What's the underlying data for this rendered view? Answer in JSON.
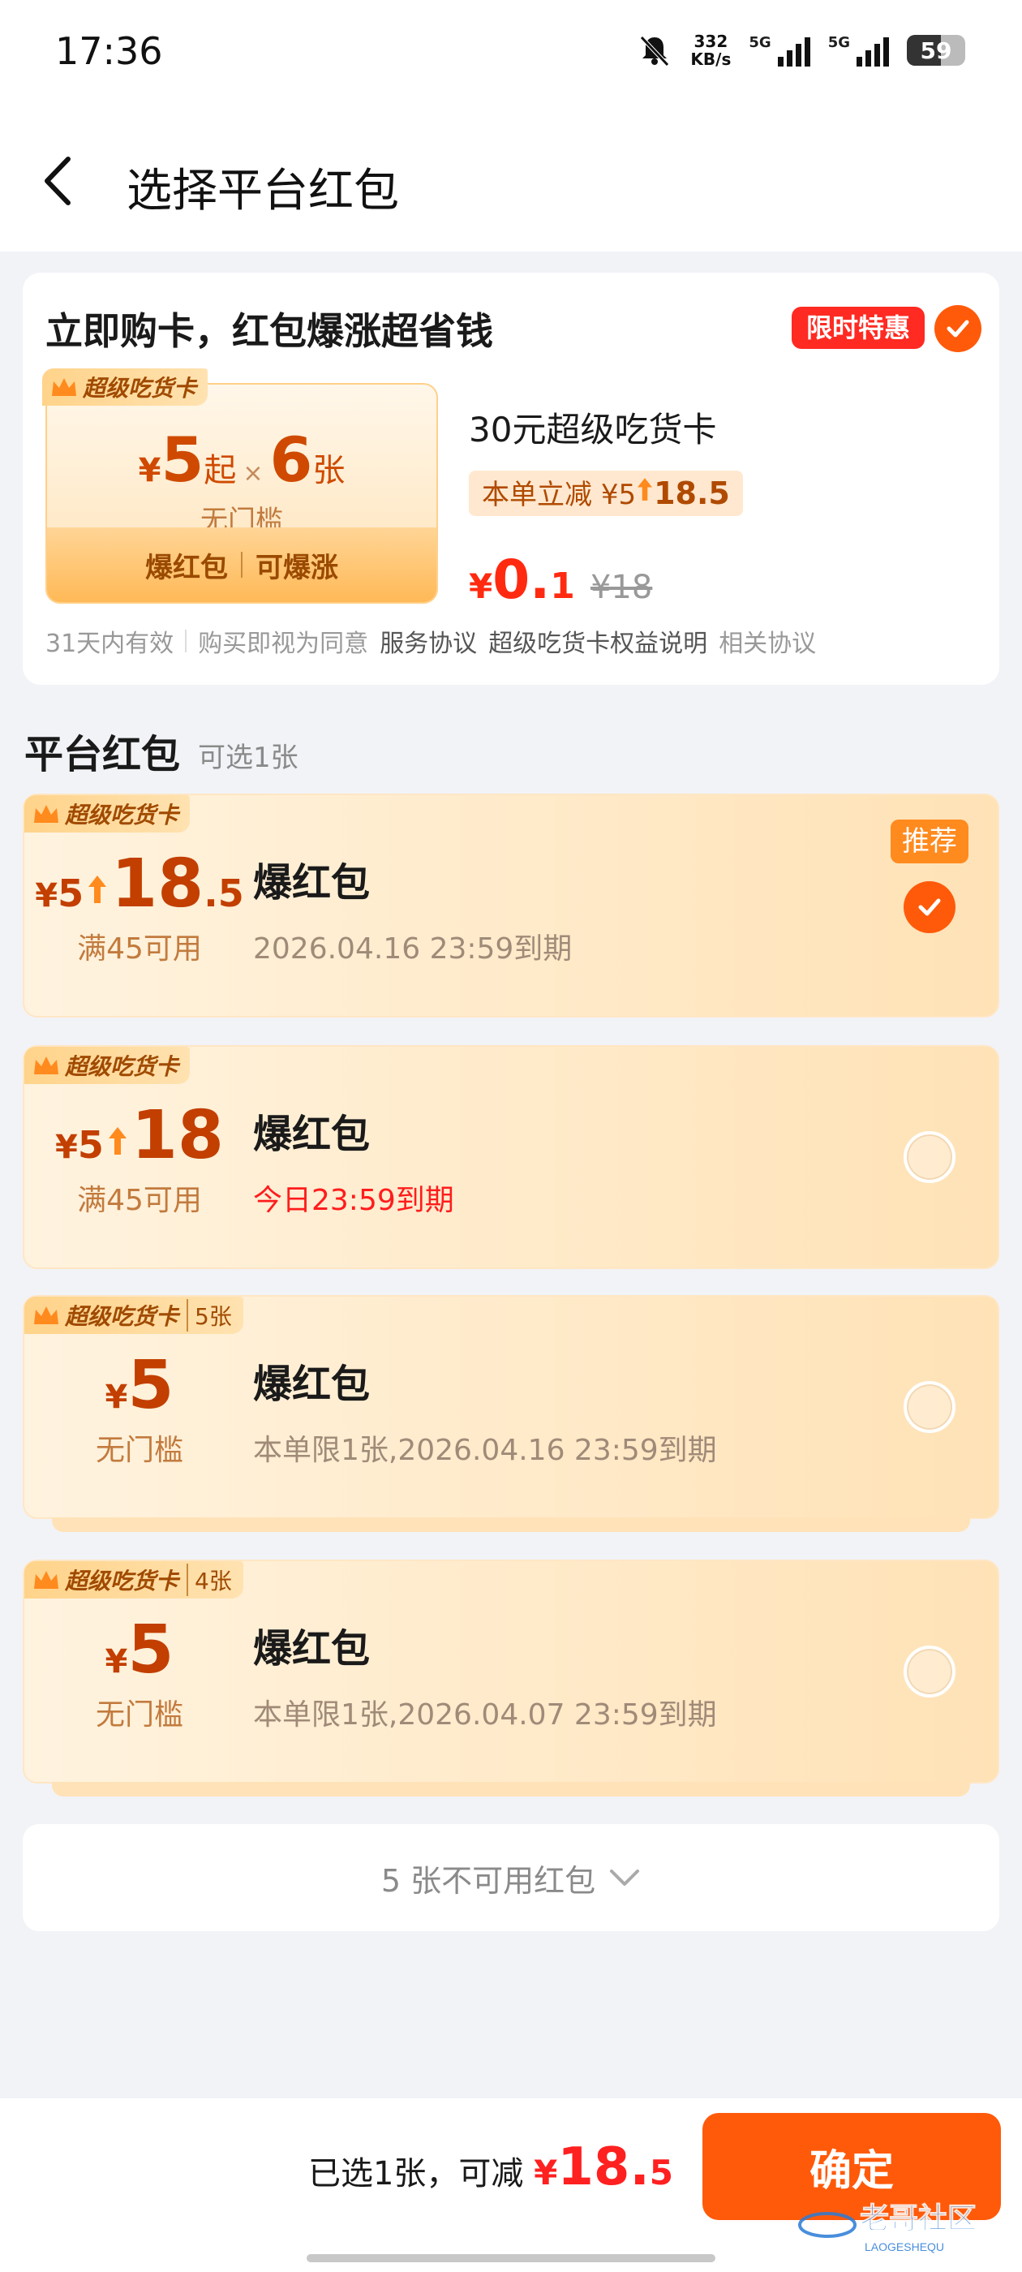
{
  "status_bar": {
    "time": "17:36",
    "net_speed_value": "332",
    "net_speed_unit": "KB/s",
    "sig1": "5G",
    "sig2": "5G",
    "battery": "59"
  },
  "nav": {
    "title": "选择平台红包"
  },
  "promo": {
    "headline": "立即购卡，红包爆涨超省钱",
    "badge": "限时特惠",
    "tag": "超级吃货卡",
    "yen": "¥",
    "amount_from": "5",
    "from_text": "起",
    "times": "×",
    "count": "6",
    "count_unit": "张",
    "no_threshold": "无门槛",
    "bottom_left": "爆红包",
    "bottom_right": "可爆涨",
    "card_name": "30元超级吃货卡",
    "save_prefix": "本单立减",
    "save_yen": "¥5",
    "save_to": "18.5",
    "price_yen": "¥",
    "price_int": "0.",
    "price_dec": "1",
    "orig_price": "¥18",
    "foot_valid": "31天内有效",
    "foot_agree": "购买即视为同意",
    "foot_service": "服务协议",
    "foot_rights": "超级吃货卡权益说明",
    "foot_related": "相关协议"
  },
  "section": {
    "title": "平台红包",
    "sub": "可选1张"
  },
  "coupons": [
    {
      "tag": "超级吃货卡",
      "count": "",
      "yen": "¥",
      "from": "5",
      "big": "18",
      "dec": ".5",
      "cond": "满45可用",
      "name": "爆红包",
      "expire": "2026.04.16 23:59到期",
      "badge": "推荐"
    },
    {
      "tag": "超级吃货卡",
      "count": "",
      "yen": "¥",
      "from": "5",
      "big": "18",
      "dec": "",
      "cond": "满45可用",
      "name": "爆红包",
      "expire": "今日23:59到期"
    },
    {
      "tag": "超级吃货卡",
      "count": "5张",
      "yen": "¥",
      "big": "5",
      "cond": "无门槛",
      "name": "爆红包",
      "expire": "本单限1张,2026.04.16 23:59到期"
    },
    {
      "tag": "超级吃货卡",
      "count": "4张",
      "yen": "¥",
      "big": "5",
      "cond": "无门槛",
      "name": "爆红包",
      "expire": "本单限1张,2026.04.07 23:59到期"
    }
  ],
  "unavailable": {
    "label": "5 张不可用红包"
  },
  "footer": {
    "selected": "已选1张，可减",
    "yen": "¥",
    "amount_int": "18.",
    "amount_dec": "5",
    "confirm": "确定",
    "watermark": "老哥社区",
    "watermark_sub": "LAOGESHEQU"
  },
  "colors": {
    "accent": "#ff5a0a",
    "price_red": "#ff2020",
    "coupon_brown": "#c23f00"
  }
}
